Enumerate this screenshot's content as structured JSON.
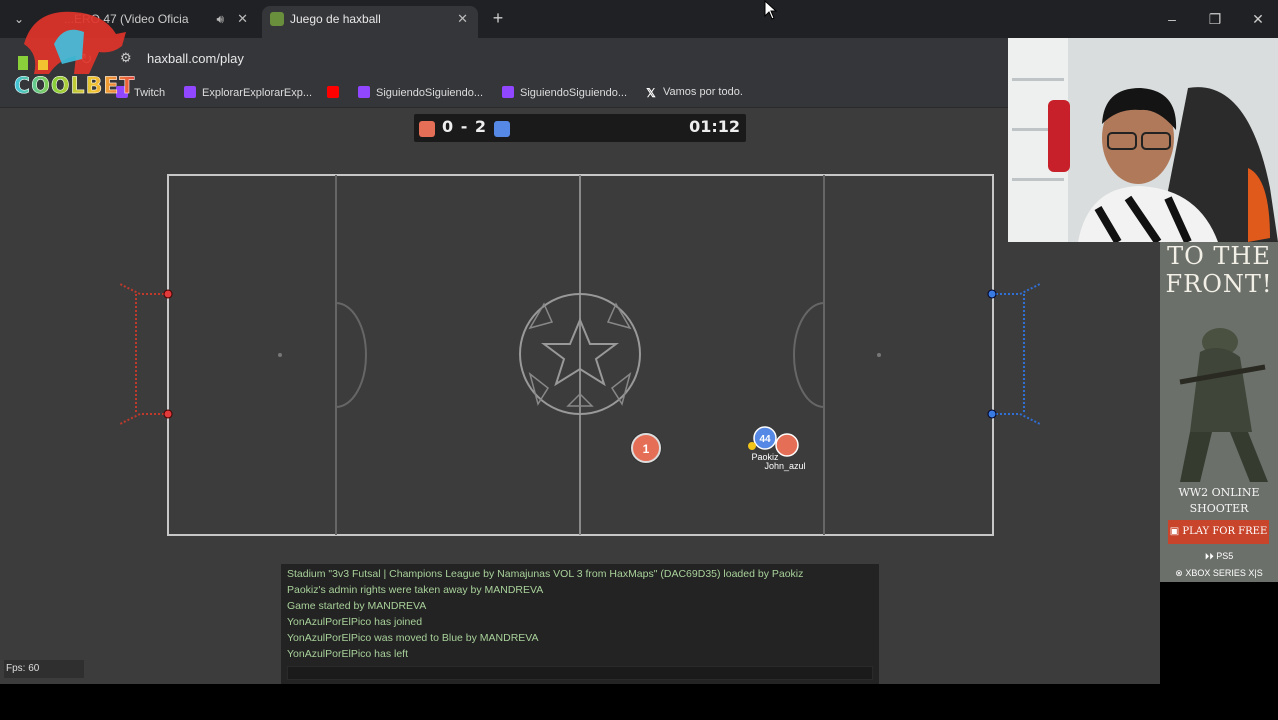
{
  "browser": {
    "tabs": [
      {
        "label": "...ERO 47 (Video Oficia",
        "active": false
      },
      {
        "label": "Juego de haxball",
        "active": true
      }
    ],
    "address": "haxball.com/play",
    "bookmarks": [
      {
        "label": "Twitch",
        "icon": "twitch-icon"
      },
      {
        "label": "ExplorarExplorarExp...",
        "icon": "twitch-icon"
      },
      {
        "label": "",
        "icon": "youtube-icon"
      },
      {
        "label": "SiguiendoSiguiendo...",
        "icon": "twitch-icon"
      },
      {
        "label": "SiguiendoSiguiendo...",
        "icon": "twitch-icon"
      },
      {
        "label": "Vamos por todo.",
        "icon": "x-icon"
      }
    ]
  },
  "overlay": {
    "logo_text": "COOLBET"
  },
  "game": {
    "score_red": 0,
    "score_blue": 2,
    "score_text": "0 - 2",
    "time": "01:12",
    "fps": "Fps: 60",
    "players": [
      {
        "label": "1",
        "team": "red"
      },
      {
        "label": "44",
        "team": "blue",
        "name": "Paokiz"
      },
      {
        "label": "",
        "team": "red",
        "name": "John_azul"
      }
    ],
    "colors": {
      "red": "#e56e56",
      "blue": "#5689e5",
      "field": "#3c3c3c",
      "lines": "#c7c7c7"
    }
  },
  "chat": {
    "messages": [
      "Stadium \"3v3 Futsal | Champions League by Namajunas VOL 3 from HaxMaps\" (DAC69D35) loaded by Paokiz",
      "Paokiz's admin rights were taken away by MANDREVA",
      "Game started by MANDREVA",
      "YonAzulPorElPico has joined",
      "YonAzulPorElPico was moved to Blue by MANDREVA",
      "YonAzulPorElPico has left"
    ]
  },
  "ad": {
    "headline": "TO THE FRONT!",
    "subline1": "WW2 ONLINE",
    "subline2": "SHOOTER",
    "button": "PLAY FOR FREE",
    "platform1": "PS5",
    "platform2": "XBOX SERIES X|S"
  }
}
